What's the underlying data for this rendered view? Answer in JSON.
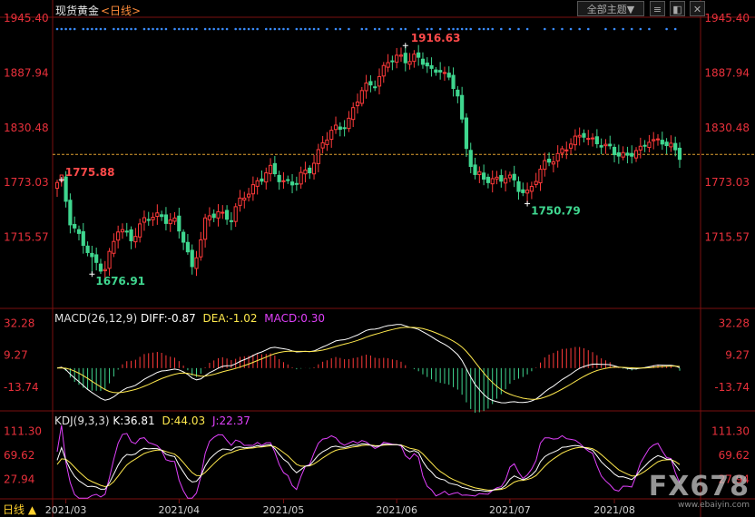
{
  "header": {
    "title": "现货黄金",
    "period": "<日线>",
    "dropdown_label": "全部主题▼",
    "icon_buttons": [
      "≡",
      "◧",
      "✕"
    ]
  },
  "indicators": {
    "macd_prefix": "MACD(26,12,9)",
    "macd_diff": "DIFF:-0.87",
    "macd_dea": "DEA:-1.02",
    "macd_macd": "MACD:0.30",
    "kdj_prefix": "KDJ(9,3,3)",
    "kdj_k": "K:36.81",
    "kdj_d": "D:44.03",
    "kdj_j": "J:22.37"
  },
  "footer": {
    "period_tab": "日线 ▲"
  },
  "watermark": {
    "brand": "FX678",
    "url": "www.ebaiyin.com"
  },
  "colors": {
    "up": "#ff3a3a",
    "down": "#3fd68f",
    "axis": "#e8303b",
    "diff": "#ffffff",
    "dea": "#ffe94d",
    "macd": "#e040fb",
    "ref": "#e0a030",
    "dots": "#3a8dff"
  },
  "chart_data": [
    {
      "type": "candlestick",
      "title": "现货黄金",
      "yticks": [
        1715.57,
        1773.03,
        1830.48,
        1887.94,
        1945.4
      ],
      "ylim": [
        1658.11,
        1945.4
      ],
      "x_tick_labels": [
        "2021/03",
        "2021/04",
        "2021/05",
        "2021/06",
        "2021/07",
        "2021/08"
      ],
      "annotations": [
        {
          "label": "1775.88",
          "value": 1775.88,
          "type": "local-high"
        },
        {
          "label": "1676.91",
          "value": 1676.91,
          "type": "low"
        },
        {
          "label": "1916.63",
          "value": 1916.63,
          "type": "high"
        },
        {
          "label": "1750.79",
          "value": 1750.79,
          "type": "local-low"
        }
      ],
      "reference_line": 1802.5,
      "anchors": [
        {
          "i": 0,
          "v": 1770
        },
        {
          "i": 1,
          "v": 1775
        },
        {
          "i": 3,
          "v": 1735
        },
        {
          "i": 8,
          "v": 1690
        },
        {
          "i": 11,
          "v": 1685
        },
        {
          "i": 14,
          "v": 1722
        },
        {
          "i": 17,
          "v": 1717
        },
        {
          "i": 20,
          "v": 1732
        },
        {
          "i": 24,
          "v": 1740
        },
        {
          "i": 27,
          "v": 1730
        },
        {
          "i": 29,
          "v": 1712
        },
        {
          "i": 31,
          "v": 1685
        },
        {
          "i": 34,
          "v": 1730
        },
        {
          "i": 37,
          "v": 1743
        },
        {
          "i": 40,
          "v": 1736
        },
        {
          "i": 43,
          "v": 1758
        },
        {
          "i": 46,
          "v": 1776
        },
        {
          "i": 49,
          "v": 1784
        },
        {
          "i": 52,
          "v": 1776
        },
        {
          "i": 55,
          "v": 1772
        },
        {
          "i": 58,
          "v": 1788
        },
        {
          "i": 61,
          "v": 1815
        },
        {
          "i": 64,
          "v": 1828
        },
        {
          "i": 67,
          "v": 1840
        },
        {
          "i": 70,
          "v": 1868
        },
        {
          "i": 73,
          "v": 1880
        },
        {
          "i": 76,
          "v": 1898
        },
        {
          "i": 79,
          "v": 1905
        },
        {
          "i": 82,
          "v": 1904
        },
        {
          "i": 84,
          "v": 1898
        },
        {
          "i": 86,
          "v": 1890
        },
        {
          "i": 88,
          "v": 1895
        },
        {
          "i": 90,
          "v": 1878
        },
        {
          "i": 92,
          "v": 1865
        },
        {
          "i": 94,
          "v": 1810
        },
        {
          "i": 96,
          "v": 1782
        },
        {
          "i": 98,
          "v": 1774
        },
        {
          "i": 100,
          "v": 1777
        },
        {
          "i": 103,
          "v": 1780
        },
        {
          "i": 106,
          "v": 1766
        },
        {
          "i": 108,
          "v": 1764
        },
        {
          "i": 110,
          "v": 1778
        },
        {
          "i": 113,
          "v": 1795
        },
        {
          "i": 116,
          "v": 1808
        },
        {
          "i": 119,
          "v": 1815
        },
        {
          "i": 121,
          "v": 1826
        },
        {
          "i": 123,
          "v": 1818
        },
        {
          "i": 126,
          "v": 1808
        },
        {
          "i": 129,
          "v": 1806
        },
        {
          "i": 131,
          "v": 1800
        },
        {
          "i": 134,
          "v": 1806
        },
        {
          "i": 136,
          "v": 1822
        },
        {
          "i": 138,
          "v": 1815
        },
        {
          "i": 141,
          "v": 1810
        },
        {
          "i": 143,
          "v": 1804
        }
      ]
    },
    {
      "type": "macd",
      "yticks": [
        -13.74,
        9.27,
        32.28
      ],
      "legend": [
        "DIFF",
        "DEA",
        "MACD"
      ],
      "current": {
        "diff": -0.87,
        "dea": -1.02,
        "macd": 0.3
      }
    },
    {
      "type": "kdj",
      "yticks": [
        27.94,
        69.62,
        111.3
      ],
      "legend": [
        "K",
        "D",
        "J"
      ],
      "current": {
        "k": 36.81,
        "d": 44.03,
        "j": 22.37
      }
    }
  ]
}
